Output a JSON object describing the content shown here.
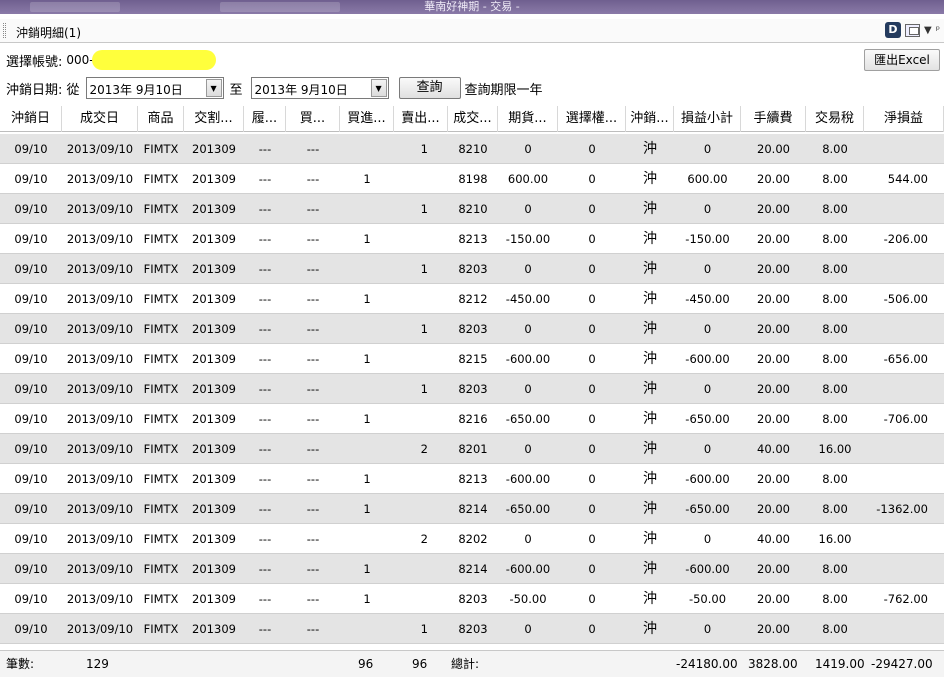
{
  "window": {
    "title": "華南好神期 - 交易 -"
  },
  "panel": {
    "title": "沖銷明細(1)",
    "d_label": "D"
  },
  "account": {
    "label": "選擇帳號:",
    "prefix": "000-"
  },
  "export_label": "匯出Excel",
  "date": {
    "label": "沖銷日期: 從",
    "from": "2013年  9月10日",
    "to_label": "至",
    "to": "2013年  9月10日",
    "query_label": "查詢",
    "limit_note": "查詢期限一年"
  },
  "columns": [
    "沖銷日",
    "成交日",
    "商品",
    "交割...",
    "履...",
    "買...",
    "買進...",
    "賣出...",
    "成交...",
    "期貨...",
    "選擇權...",
    "沖銷...",
    "損益小計",
    "手續費",
    "交易稅",
    "淨損益"
  ],
  "rows": [
    [
      "09/10",
      "2013/09/10",
      "FIMTX",
      "201309",
      "---",
      "---",
      "",
      "1",
      "8210",
      "0",
      "0",
      "沖",
      "0",
      "20.00",
      "8.00",
      ""
    ],
    [
      "09/10",
      "2013/09/10",
      "FIMTX",
      "201309",
      "---",
      "---",
      "1",
      "",
      "8198",
      "600.00",
      "0",
      "沖",
      "600.00",
      "20.00",
      "8.00",
      "544.00"
    ],
    [
      "09/10",
      "2013/09/10",
      "FIMTX",
      "201309",
      "---",
      "---",
      "",
      "1",
      "8210",
      "0",
      "0",
      "沖",
      "0",
      "20.00",
      "8.00",
      ""
    ],
    [
      "09/10",
      "2013/09/10",
      "FIMTX",
      "201309",
      "---",
      "---",
      "1",
      "",
      "8213",
      "-150.00",
      "0",
      "沖",
      "-150.00",
      "20.00",
      "8.00",
      "-206.00"
    ],
    [
      "09/10",
      "2013/09/10",
      "FIMTX",
      "201309",
      "---",
      "---",
      "",
      "1",
      "8203",
      "0",
      "0",
      "沖",
      "0",
      "20.00",
      "8.00",
      ""
    ],
    [
      "09/10",
      "2013/09/10",
      "FIMTX",
      "201309",
      "---",
      "---",
      "1",
      "",
      "8212",
      "-450.00",
      "0",
      "沖",
      "-450.00",
      "20.00",
      "8.00",
      "-506.00"
    ],
    [
      "09/10",
      "2013/09/10",
      "FIMTX",
      "201309",
      "---",
      "---",
      "",
      "1",
      "8203",
      "0",
      "0",
      "沖",
      "0",
      "20.00",
      "8.00",
      ""
    ],
    [
      "09/10",
      "2013/09/10",
      "FIMTX",
      "201309",
      "---",
      "---",
      "1",
      "",
      "8215",
      "-600.00",
      "0",
      "沖",
      "-600.00",
      "20.00",
      "8.00",
      "-656.00"
    ],
    [
      "09/10",
      "2013/09/10",
      "FIMTX",
      "201309",
      "---",
      "---",
      "",
      "1",
      "8203",
      "0",
      "0",
      "沖",
      "0",
      "20.00",
      "8.00",
      ""
    ],
    [
      "09/10",
      "2013/09/10",
      "FIMTX",
      "201309",
      "---",
      "---",
      "1",
      "",
      "8216",
      "-650.00",
      "0",
      "沖",
      "-650.00",
      "20.00",
      "8.00",
      "-706.00"
    ],
    [
      "09/10",
      "2013/09/10",
      "FIMTX",
      "201309",
      "---",
      "---",
      "",
      "2",
      "8201",
      "0",
      "0",
      "沖",
      "0",
      "40.00",
      "16.00",
      ""
    ],
    [
      "09/10",
      "2013/09/10",
      "FIMTX",
      "201309",
      "---",
      "---",
      "1",
      "",
      "8213",
      "-600.00",
      "0",
      "沖",
      "-600.00",
      "20.00",
      "8.00",
      ""
    ],
    [
      "09/10",
      "2013/09/10",
      "FIMTX",
      "201309",
      "---",
      "---",
      "1",
      "",
      "8214",
      "-650.00",
      "0",
      "沖",
      "-650.00",
      "20.00",
      "8.00",
      "-1362.00"
    ],
    [
      "09/10",
      "2013/09/10",
      "FIMTX",
      "201309",
      "---",
      "---",
      "",
      "2",
      "8202",
      "0",
      "0",
      "沖",
      "0",
      "40.00",
      "16.00",
      ""
    ],
    [
      "09/10",
      "2013/09/10",
      "FIMTX",
      "201309",
      "---",
      "---",
      "1",
      "",
      "8214",
      "-600.00",
      "0",
      "沖",
      "-600.00",
      "20.00",
      "8.00",
      ""
    ],
    [
      "09/10",
      "2013/09/10",
      "FIMTX",
      "201309",
      "---",
      "---",
      "1",
      "",
      "8203",
      "-50.00",
      "0",
      "沖",
      "-50.00",
      "20.00",
      "8.00",
      "-762.00"
    ],
    [
      "09/10",
      "2013/09/10",
      "FIMTX",
      "201309",
      "---",
      "---",
      "",
      "1",
      "8203",
      "0",
      "0",
      "沖",
      "0",
      "20.00",
      "8.00",
      ""
    ]
  ],
  "footer": {
    "count_label": "筆數:",
    "count": "129",
    "buy_total": "96",
    "sell_total": "96",
    "total_label": "總計:",
    "pnl_total": "-24180.00",
    "fee_total": "3828.00",
    "tax_total": "1419.00",
    "net_total": "-29427.00"
  }
}
